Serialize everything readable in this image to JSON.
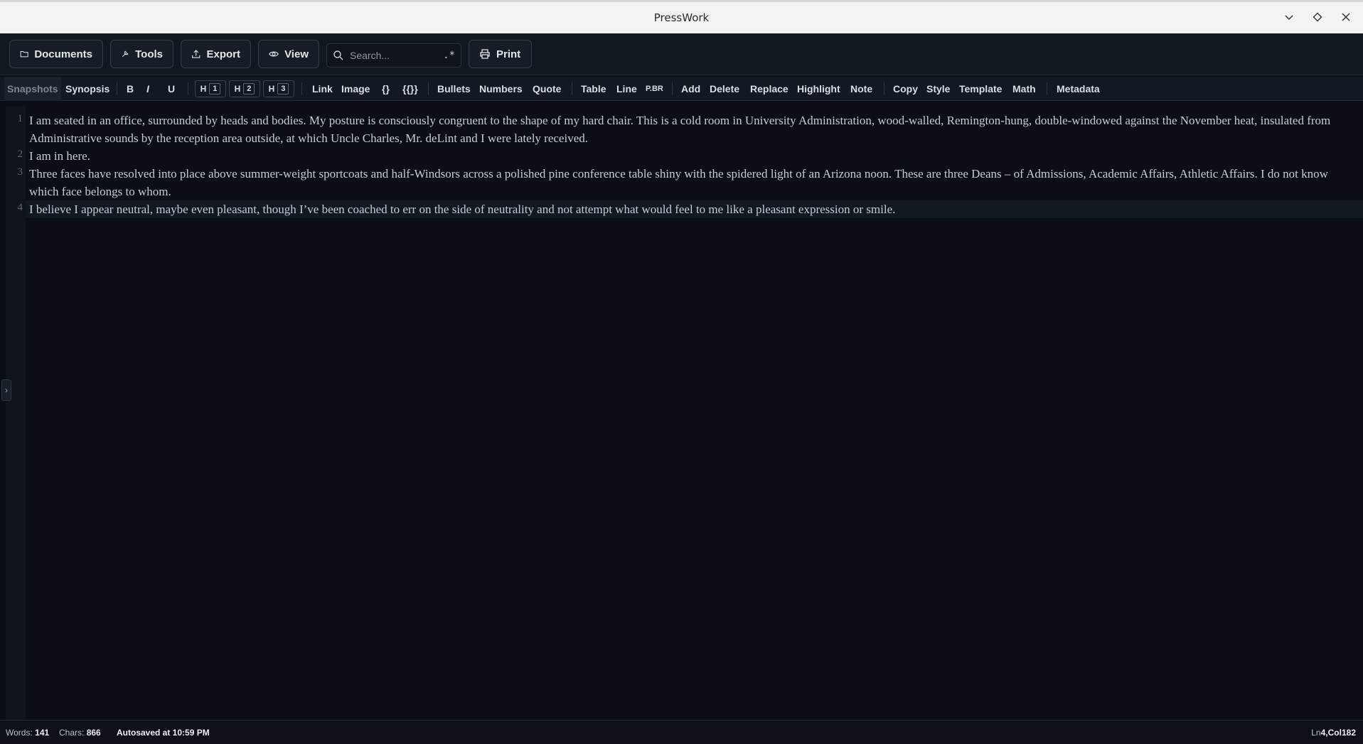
{
  "window": {
    "title": "PressWork"
  },
  "toolbar": {
    "documents": "Documents",
    "tools": "Tools",
    "export": "Export",
    "view": "View",
    "search_placeholder": "Search...",
    "regex": ".*",
    "print": "Print"
  },
  "format": {
    "snapshots": "Snapshots",
    "synopsis": "Synopsis",
    "bold": "B",
    "italic": "I",
    "underline": "U",
    "h_letter": "H",
    "h1": "1",
    "h2": "2",
    "h3": "3",
    "link": "Link",
    "image": "Image",
    "braces": "{}",
    "double_braces": "{{}}",
    "bullets": "Bullets",
    "numbers": "Numbers",
    "quote": "Quote",
    "table": "Table",
    "line": "Line",
    "pbr": "P.BR",
    "add": "Add",
    "delete": "Delete",
    "replace": "Replace",
    "highlight": "Highlight",
    "note": "Note",
    "copy": "Copy",
    "style": "Style",
    "template": "Template",
    "math": "Math",
    "metadata": "Metadata"
  },
  "editor": {
    "lines": [
      {
        "num": "1",
        "text": "I am seated in an office, surrounded by heads and bodies. My posture is consciously congruent to the shape of my hard chair. This is a cold room in University Administration, wood-walled, Remington-hung, double-windowed against the November heat, insulated from Administrative sounds by the reception area outside, at which Uncle Charles, Mr. deLint and I were lately received."
      },
      {
        "num": "2",
        "text": "I am in here."
      },
      {
        "num": "3",
        "text": "Three faces have resolved into place above summer-weight sportcoats and half-Windsors across a polished pine conference table shiny with the spidered light of an Arizona noon. These are three Deans – of Admissions, Academic Affairs, Athletic Affairs. I do not know which face belongs to whom."
      },
      {
        "num": "4",
        "text": "I believe I appear neutral, maybe even pleasant, though I’ve been coached to err on the side of neutrality and not attempt what would feel to me like a pleasant expression or smile."
      }
    ],
    "collapse_glyph": "›"
  },
  "status": {
    "words_label": "Words:",
    "words": "141",
    "chars_label": "Chars:",
    "chars": "866",
    "autosave": "Autosaved at 10:59 PM",
    "ln_label": "Ln",
    "ln": "4",
    "col_label": ",Col",
    "col": "182"
  }
}
